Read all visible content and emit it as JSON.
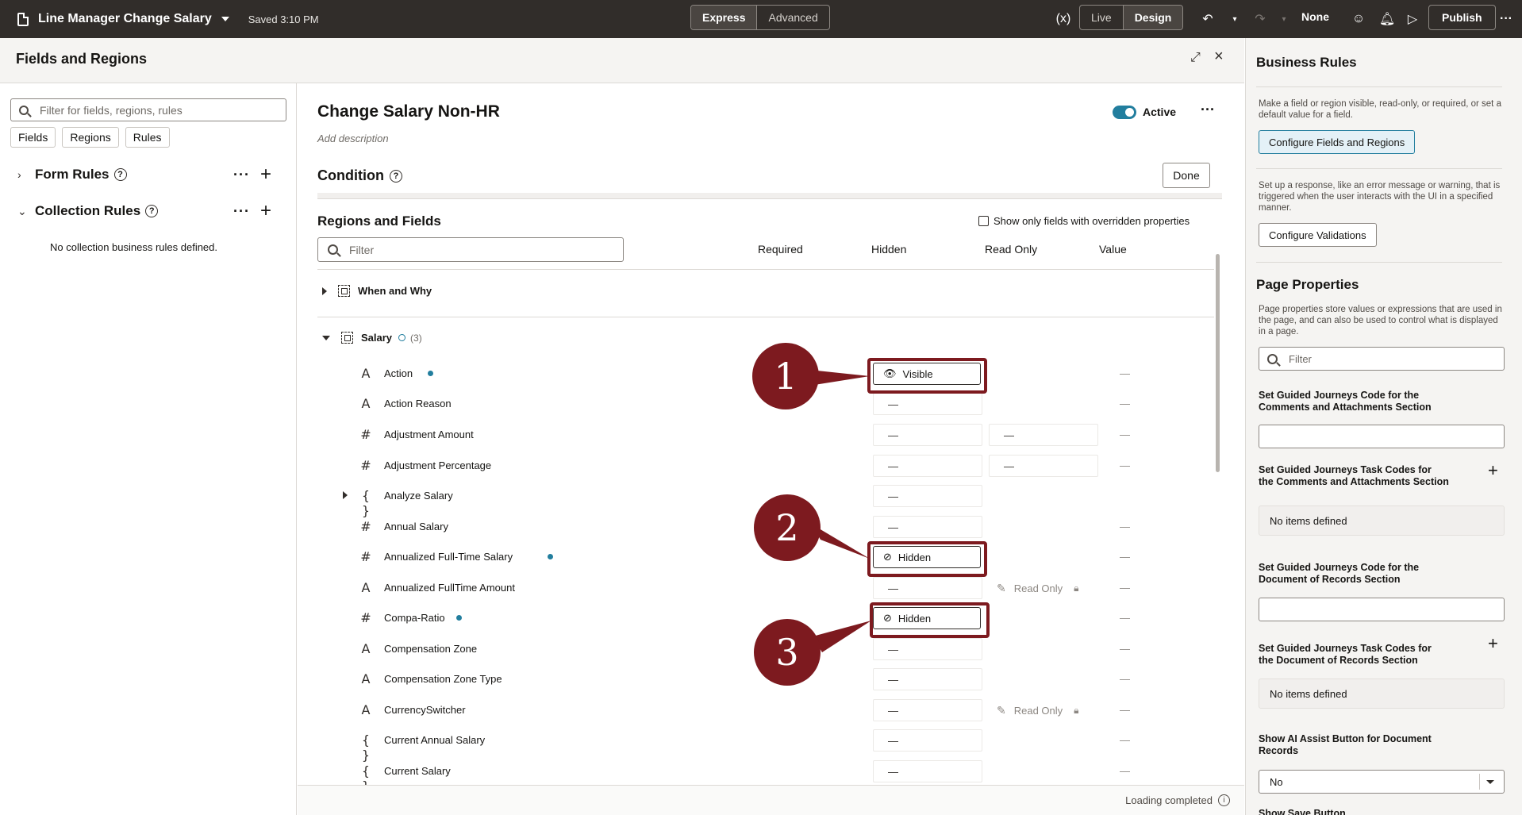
{
  "topbar": {
    "app_title": "Line Manager Change Salary",
    "saved": "Saved 3:10 PM",
    "mode_express": "Express",
    "mode_advanced": "Advanced",
    "view_live": "Live",
    "view_design": "Design",
    "none_label": "None",
    "publish": "Publish"
  },
  "left": {
    "panel_title": "Fields and Regions",
    "search_placeholder": "Filter for fields, regions, rules",
    "chips": [
      "Fields",
      "Regions",
      "Rules"
    ],
    "form_rules": "Form Rules",
    "collection_rules": "Collection Rules",
    "no_collection": "No collection business rules defined."
  },
  "center": {
    "rule_title": "Change Salary Non-HR",
    "active": "Active",
    "add_description": "Add description",
    "condition": "Condition",
    "done": "Done",
    "regions_title": "Regions and Fields",
    "show_only": "Show only fields with overridden properties",
    "filter_placeholder": "Filter",
    "columns": {
      "required": "Required",
      "hidden": "Hidden",
      "read_only": "Read Only",
      "value": "Value"
    },
    "groups": {
      "when": "When and Why",
      "salary": "Salary",
      "salary_count": "(3)"
    },
    "rows": [
      {
        "name": "Action",
        "type": "A",
        "dot": true,
        "state": "Visible"
      },
      {
        "name": "Action Reason",
        "type": "A",
        "hidden": "—"
      },
      {
        "name": "Adjustment Amount",
        "type": "#",
        "hidden": "—",
        "ro": "—"
      },
      {
        "name": "Adjustment Percentage",
        "type": "#",
        "hidden": "—",
        "ro": "—"
      },
      {
        "name": "Analyze Salary",
        "type": "{ }",
        "hidden": "—"
      },
      {
        "name": "Annual Salary",
        "type": "#",
        "hidden": "—"
      },
      {
        "name": "Annualized Full-Time Salary",
        "type": "#",
        "dot": true,
        "state": "Hidden"
      },
      {
        "name": "Annualized FullTime Amount",
        "type": "A",
        "hidden": "—",
        "readonly_text": "Read Only"
      },
      {
        "name": "Compa-Ratio",
        "type": "#",
        "dot": true,
        "state": "Hidden"
      },
      {
        "name": "Compensation Zone",
        "type": "A",
        "hidden": "—"
      },
      {
        "name": "Compensation Zone Type",
        "type": "A",
        "hidden": "—"
      },
      {
        "name": "CurrencySwitcher",
        "type": "A",
        "hidden": "—",
        "readonly_text": "Read Only"
      },
      {
        "name": "Current Annual Salary",
        "type": "{ }",
        "hidden": "—"
      },
      {
        "name": "Current Salary",
        "type": "{ }",
        "hidden": "—"
      }
    ],
    "value_dash": "—",
    "callouts": [
      "1",
      "2",
      "3"
    ],
    "footer": "Loading completed"
  },
  "right": {
    "title": "Business Rules",
    "desc1": "Make a field or region visible, read-only, or required, or set a default value for a field.",
    "btn_configure_fields": "Configure Fields and Regions",
    "desc2": "Set up a response, like an error message or warning, that is triggered when the user interacts with the UI in a specified manner.",
    "btn_configure_validations": "Configure Validations",
    "page_props": "Page Properties",
    "desc3": "Page properties store values or expressions that are used in the page, and can also be used to control what is displayed in a page.",
    "filter_placeholder": "Filter",
    "prop1": "Set Guided Journeys Code for the Comments and Attachments Section",
    "prop2": "Set Guided Journeys Task Codes for the Comments and Attachments Section",
    "no_items": "No items defined",
    "prop3": "Set Guided Journeys Code for the Document of Records Section",
    "prop4": "Set Guided Journeys Task Codes for the Document of Records Section",
    "prop5": "Show AI Assist Button for Document Records",
    "select_value": "No",
    "prop6_partial": "Show Save Button"
  },
  "colors": {
    "accent": "#227e9e",
    "callout": "#7d1a1f",
    "topbar": "#312d2a"
  }
}
